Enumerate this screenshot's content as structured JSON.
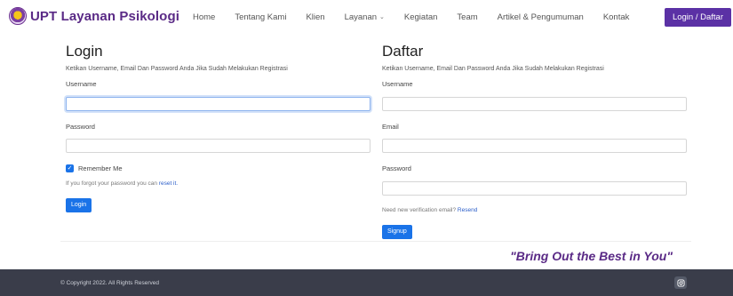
{
  "header": {
    "brand": "UPT Layanan Psikologi",
    "nav": [
      "Home",
      "Tentang Kami",
      "Klien",
      "Layanan",
      "Kegiatan",
      "Team",
      "Artikel & Pengumuman",
      "Kontak"
    ],
    "login_daftar": "Login / Daftar"
  },
  "login": {
    "title": "Login",
    "subtitle": "Ketikan Username, Email Dan Password Anda Jika Sudah Melakukan Registrasi",
    "username_label": "Username",
    "password_label": "Password",
    "remember": "Remember Me",
    "forgot_text": "If you forgot your password you can",
    "reset_link": "reset it.",
    "button": "Login"
  },
  "daftar": {
    "title": "Daftar",
    "subtitle": "Ketikan Username, Email Dan Password Anda Jika Sudah Melakukan Registrasi",
    "username_label": "Username",
    "email_label": "Email",
    "password_label": "Password",
    "verify_text": "Need new verification email?",
    "resend_link": "Resend",
    "button": "Signup"
  },
  "tagline": "\"Bring Out the Best in You\"",
  "footer": {
    "copyright": "© Copyright 2022. All Rights Reserved"
  },
  "icons": {
    "logo": "logo-icon",
    "dropdown": "chevron-down-icon",
    "check": "check-icon",
    "social": "instagram-icon"
  },
  "colors": {
    "brand": "#5a2a86",
    "primary": "#1a73e8",
    "footer": "#3a3d4a"
  }
}
